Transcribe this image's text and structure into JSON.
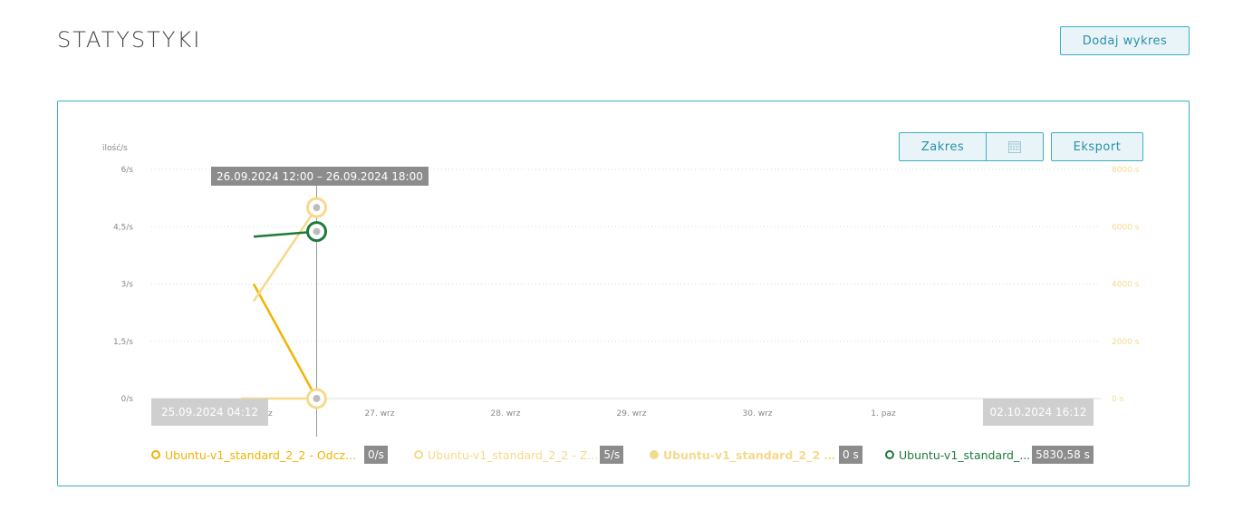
{
  "page": {
    "title": "STATYSTYKI",
    "add_chart_label": "Dodaj wykres"
  },
  "toolbar": {
    "range_label": "Zakres",
    "calendar_icon": "calendar-icon",
    "export_label": "Eksport"
  },
  "colors": {
    "accent": "#3aaec7",
    "series_read": "#f0b400",
    "series_write": "#f6d98a",
    "series_other": "#f6d98a",
    "series_green": "#1e7a3a",
    "label_bg": "#8c8c8c",
    "date_bg": "#cfcfcf"
  },
  "chart_data": {
    "type": "line",
    "y_left_label": "ilość/s",
    "y_left_ticks": [
      "6/s",
      "4,5/s",
      "3/s",
      "1,5/s",
      "0/s"
    ],
    "y_left_range": [
      0,
      6
    ],
    "y_right_ticks": [
      "8000 s",
      "6000 s",
      "4000 s",
      "2000 s",
      "0 s"
    ],
    "y_right_range": [
      0,
      8000
    ],
    "x_ticks": [
      "26. wrz",
      "27. wrz",
      "28. wrz",
      "29. wrz",
      "30. wrz",
      "1. paz"
    ],
    "x_tick_partial": "z",
    "grid": true,
    "tooltip": "26.09.2024 12:00 – 26.09.2024 18:00",
    "range_start": "25.09.2024 04:12",
    "range_end": "02.10.2024 16:12",
    "series": [
      {
        "name": "Ubuntu-v1_standard_2_2 - Odczyt...",
        "value": "0/s",
        "axis": "left",
        "color": "#f0b400",
        "points": [
          [
            0.0,
            3.0
          ],
          [
            0.5,
            0.0
          ]
        ]
      },
      {
        "name": "Ubuntu-v1_standard_2_2 - Z...",
        "value": "5/s",
        "axis": "left",
        "color": "#f6d98a",
        "points": [
          [
            0.0,
            2.55
          ],
          [
            0.5,
            5.0
          ]
        ]
      },
      {
        "name": "Ubuntu-v1_standard_2_2 - O...",
        "value": "0 s",
        "axis": "right",
        "color": "#f6d98a",
        "filled": true,
        "points": [
          [
            -0.1,
            0
          ],
          [
            0.5,
            0
          ]
        ]
      },
      {
        "name": "Ubuntu-v1_standard_...",
        "value": "5830,58 s",
        "axis": "right",
        "color": "#1e7a3a",
        "points": [
          [
            0.0,
            5650
          ],
          [
            0.5,
            5830.58
          ]
        ]
      }
    ]
  }
}
